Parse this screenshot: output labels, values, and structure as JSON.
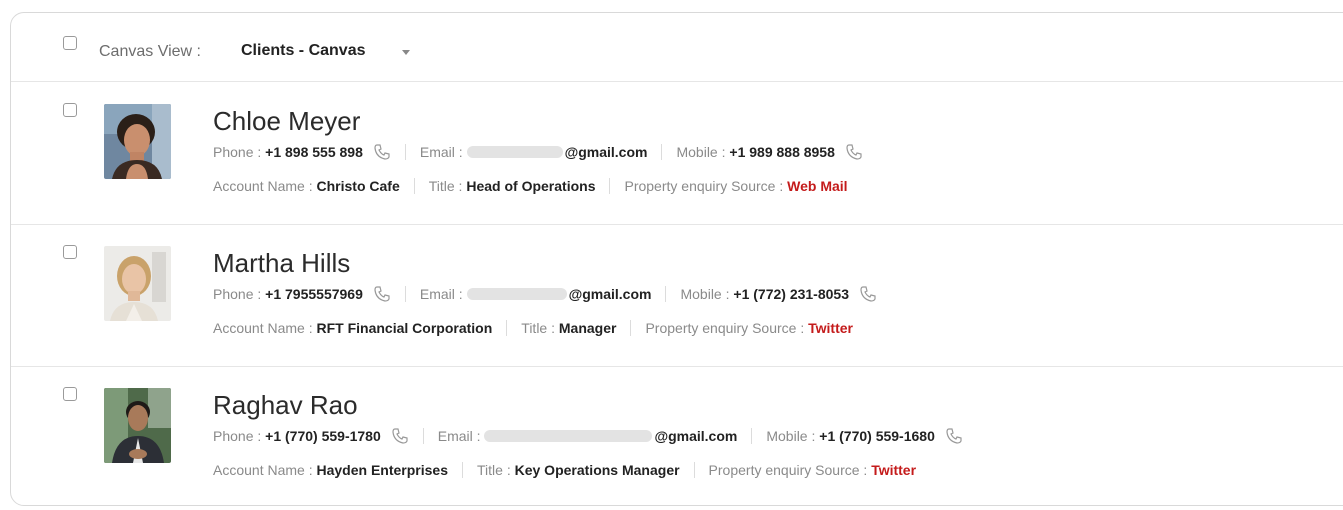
{
  "header": {
    "view_label": "Canvas View :",
    "view_value": "Clients - Canvas"
  },
  "labels": {
    "phone": "Phone :",
    "email": "Email :",
    "mobile": "Mobile :",
    "account": "Account Name :",
    "title": "Title :",
    "source": "Property enquiry Source :"
  },
  "contacts": [
    {
      "name": "Chloe Meyer",
      "phone": "+1 898 555 898",
      "email": "@gmail.com",
      "mobile": "+1 989 888 8958",
      "account": "Christo Cafe",
      "title": "Head of Operations",
      "source": "Web Mail"
    },
    {
      "name": "Martha Hills",
      "phone": "+1 7955557969",
      "email": "@gmail.com",
      "mobile": "+1 (772) 231-8053",
      "account": "RFT Financial Corporation",
      "title": "Manager",
      "source": "Twitter"
    },
    {
      "name": "Raghav Rao",
      "phone": "+1 (770) 559-1780",
      "email": "@gmail.com",
      "mobile": "+1 (770) 559-1680",
      "account": "Hayden Enterprises",
      "title": "Key Operations Manager",
      "source": "Twitter"
    }
  ],
  "colors": {
    "source_red": "#c41b1b",
    "border": "#d9d9d9"
  }
}
